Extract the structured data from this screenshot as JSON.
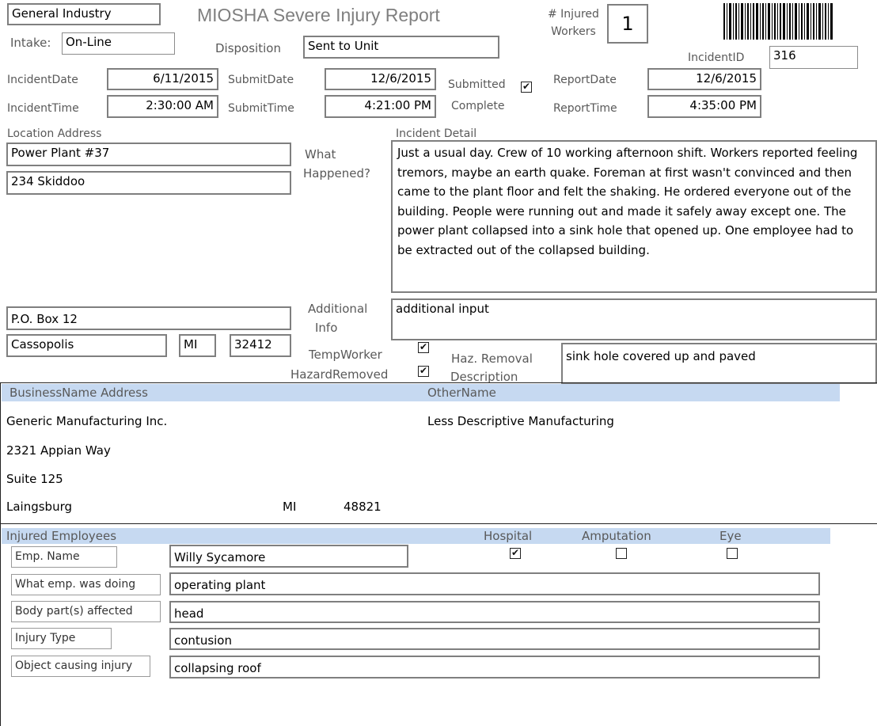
{
  "header": {
    "industry": "General Industry",
    "title": "MIOSHA Severe Injury Report",
    "injured_workers_label": "# Injured\nWorkers",
    "injured_workers_label_1": "# Injured",
    "injured_workers_label_2": "Workers",
    "injured_workers_count": "1",
    "intake_label": "Intake:",
    "intake_value": "On-Line",
    "disposition_label": "Disposition",
    "disposition_value": "Sent to Unit",
    "incident_id_label": "IncidentID",
    "incident_id_value": "316"
  },
  "dates": {
    "incident_date_label": "IncidentDate",
    "incident_date": "6/11/2015",
    "incident_time_label": "IncidentTime",
    "incident_time": "2:30:00 AM",
    "submit_date_label": "SubmitDate",
    "submit_date": "12/6/2015",
    "submit_time_label": "SubmitTime",
    "submit_time": "4:21:00 PM",
    "submitted_label": "Submitted",
    "submitted_checked": true,
    "complete_label": "Complete",
    "report_date_label": "ReportDate",
    "report_date": "12/6/2015",
    "report_time_label": "ReportTime",
    "report_time": "4:35:00 PM"
  },
  "location": {
    "label": "Location Address",
    "line1": "Power Plant #37",
    "line2": "234 Skiddoo",
    "po_box": "P.O. Box 12",
    "city": "Cassopolis",
    "state": "MI",
    "zip": "32412"
  },
  "incident": {
    "detail_label": "Incident Detail",
    "what_happened_label_1": "What",
    "what_happened_label_2": "Happened?",
    "detail_text": "Just a usual day.  Crew of 10 working afternoon shift.  Workers reported feeling tremors, maybe an earth quake.  Foreman at first wasn't convinced and then came to the plant floor and felt the shaking.  He ordered everyone out of the building.  People were running out and made it safely away except one.  The power plant collapsed into a sink hole that opened up.  One employee had to be extracted out of the collapsed building.",
    "additional_label_1": "Additional",
    "additional_label_2": "Info",
    "additional_text": "additional input",
    "temp_worker_label": "TempWorker",
    "temp_worker_checked": true,
    "hazard_removed_label": "HazardRemoved",
    "hazard_removed_checked": true,
    "haz_removal_label_1": "Haz. Removal",
    "haz_removal_label_2": "Description",
    "haz_removal_text": "sink hole covered up and paved"
  },
  "business": {
    "header_label": "BusinessName  Address",
    "other_name_label": "OtherName",
    "name": "Generic Manufacturing Inc.",
    "other_name": "Less Descriptive Manufacturing",
    "address1": "2321 Appian Way",
    "address2": "Suite 125",
    "city": "Laingsburg",
    "state": "MI",
    "zip": "48821"
  },
  "employees": {
    "header_label": "Injured Employees",
    "hospital_label": "Hospital",
    "amputation_label": "Amputation",
    "eye_label": "Eye",
    "hospital_checked": true,
    "amputation_checked": false,
    "eye_checked": false,
    "emp_name_label": "Emp.  Name",
    "emp_name": "Willy Sycamore",
    "doing_label": "What emp. was doing",
    "doing": "operating plant",
    "body_part_label": "Body part(s) affected",
    "body_part": "head",
    "injury_type_label": "Injury Type",
    "injury_type": "contusion",
    "object_label": "Object causing injury",
    "object": "collapsing roof"
  }
}
